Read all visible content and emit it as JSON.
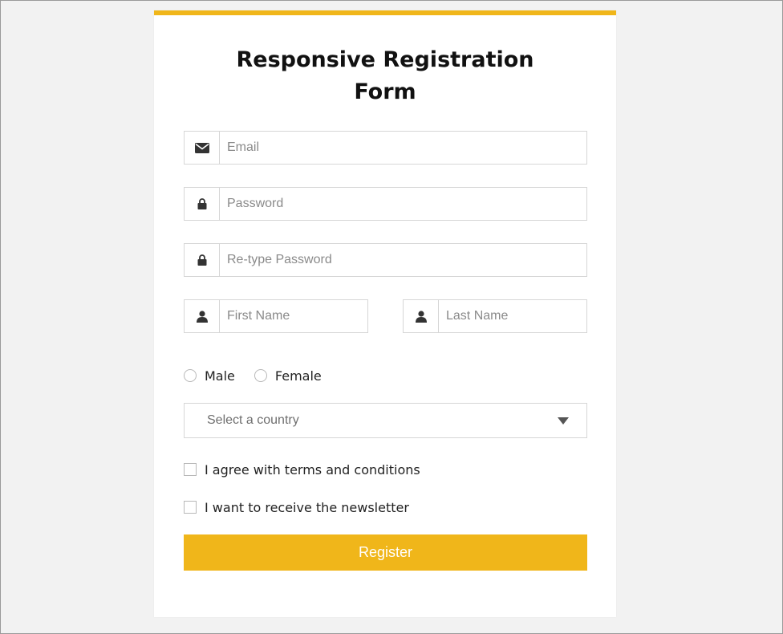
{
  "form": {
    "title": "Responsive Registration Form",
    "accent_color": "#f0b61a",
    "email": {
      "placeholder": "Email",
      "icon": "envelope-icon"
    },
    "password": {
      "placeholder": "Password",
      "icon": "lock-icon"
    },
    "retype_password": {
      "placeholder": "Re-type Password",
      "icon": "lock-icon"
    },
    "first_name": {
      "placeholder": "First Name",
      "icon": "user-icon"
    },
    "last_name": {
      "placeholder": "Last Name",
      "icon": "user-icon"
    },
    "gender": {
      "options": [
        "Male",
        "Female"
      ],
      "selected": null
    },
    "country": {
      "placeholder": "Select a country",
      "icon": "chevron-down-icon"
    },
    "terms_label": "I agree with terms and conditions",
    "terms_checked": false,
    "newsletter_label": "I want to receive the newsletter",
    "newsletter_checked": false,
    "submit_label": "Register"
  }
}
